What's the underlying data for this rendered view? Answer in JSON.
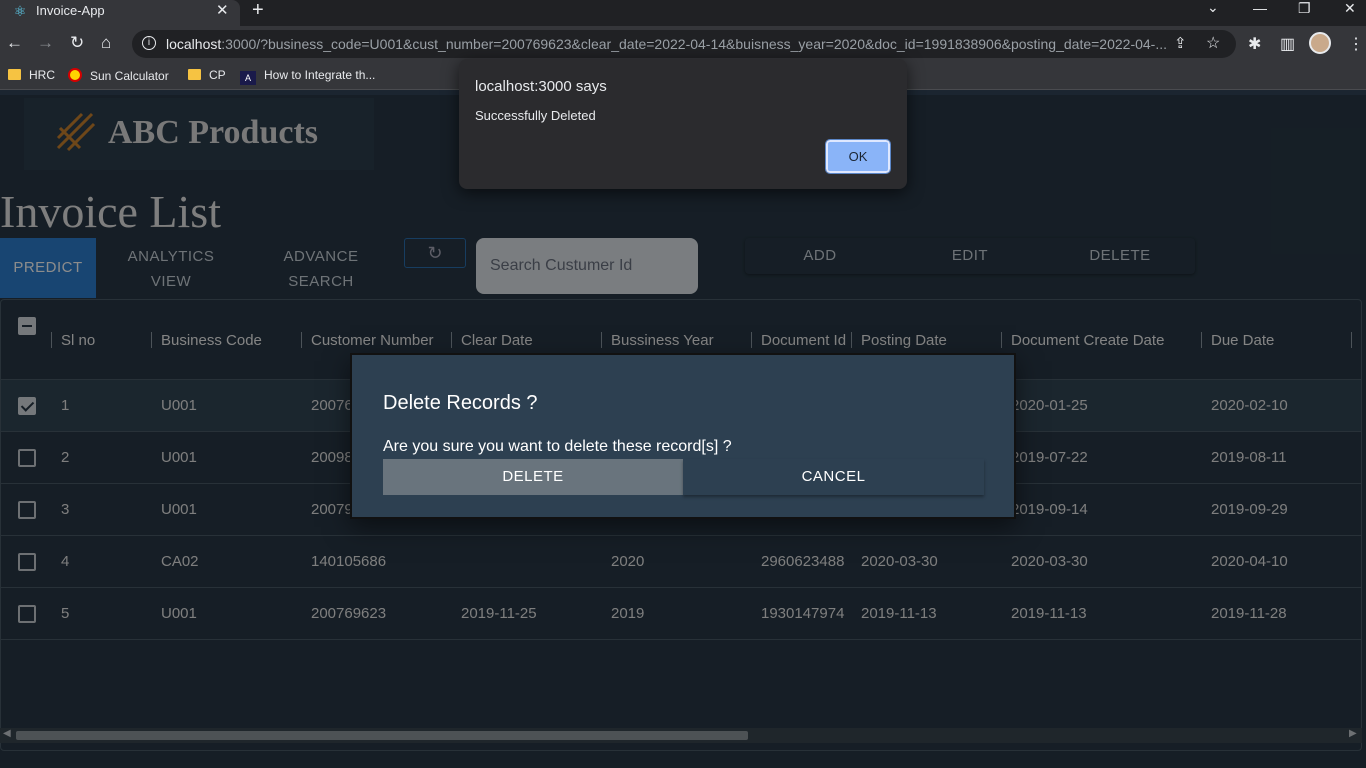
{
  "browser": {
    "tab_title": "Invoice-App",
    "url_host": "localhost",
    "url_rest": ":3000/?business_code=U001&cust_number=200769623&clear_date=2022-04-14&buisness_year=2020&doc_id=1991838906&posting_date=2022-04-...",
    "bookmarks": [
      {
        "label": "HRC",
        "icon": "folder-icon"
      },
      {
        "label": "Sun Calculator",
        "icon": "sun-icon"
      },
      {
        "label": "CP",
        "icon": "folder-icon"
      },
      {
        "label": "How to Integrate th...",
        "icon": "a-icon"
      }
    ]
  },
  "alert": {
    "title": "localhost:3000 says",
    "message": "Successfully Deleted",
    "ok_label": "OK"
  },
  "header": {
    "logo_text": "ABC Products",
    "page_title": "Invoice List"
  },
  "toolbar": {
    "predict": "PREDICT",
    "analytics_line1": "ANALYTICS",
    "analytics_line2": "VIEW",
    "advance_line1": "ADVANCE",
    "advance_line2": "SEARCH",
    "refresh_icon": "refresh-icon",
    "search_placeholder": "Search Custumer Id",
    "add": "ADD",
    "edit": "EDIT",
    "delete": "DELETE"
  },
  "table": {
    "columns": [
      "Sl no",
      "Business Code",
      "Customer Number",
      "Clear Date",
      "Bussiness Year",
      "Document Id",
      "Posting Date",
      "Document Create Date",
      "Due Date"
    ],
    "rows": [
      {
        "checked": true,
        "sl": "1",
        "business_code": "U001",
        "customer_number": "20076",
        "clear_date": "",
        "year": "",
        "doc_id": "",
        "posting_date": "",
        "create_date": "2020-01-25",
        "due_date": "2020-02-10"
      },
      {
        "checked": false,
        "sl": "2",
        "business_code": "U001",
        "customer_number": "20098",
        "clear_date": "",
        "year": "",
        "doc_id": "",
        "posting_date": "",
        "create_date": "2019-07-22",
        "due_date": "2019-08-11"
      },
      {
        "checked": false,
        "sl": "3",
        "business_code": "U001",
        "customer_number": "20079",
        "clear_date": "",
        "year": "",
        "doc_id": "",
        "posting_date": "",
        "create_date": "2019-09-14",
        "due_date": "2019-09-29"
      },
      {
        "checked": false,
        "sl": "4",
        "business_code": "CA02",
        "customer_number": "140105686",
        "clear_date": "",
        "year": "2020",
        "doc_id": "2960623488",
        "posting_date": "2020-03-30",
        "create_date": "2020-03-30",
        "due_date": "2020-04-10"
      },
      {
        "checked": false,
        "sl": "5",
        "business_code": "U001",
        "customer_number": "200769623",
        "clear_date": "2019-11-25",
        "year": "2019",
        "doc_id": "1930147974",
        "posting_date": "2019-11-13",
        "create_date": "2019-11-13",
        "due_date": "2019-11-28"
      }
    ]
  },
  "modal": {
    "title": "Delete Records ?",
    "text": "Are you sure you want to delete these record[s] ?",
    "delete_label": "DELETE",
    "cancel_label": "CANCEL"
  },
  "colors": {
    "page_bg": "#283845",
    "predict_accent": "#2d7fd0",
    "alert_button": "#8ab4f8"
  }
}
